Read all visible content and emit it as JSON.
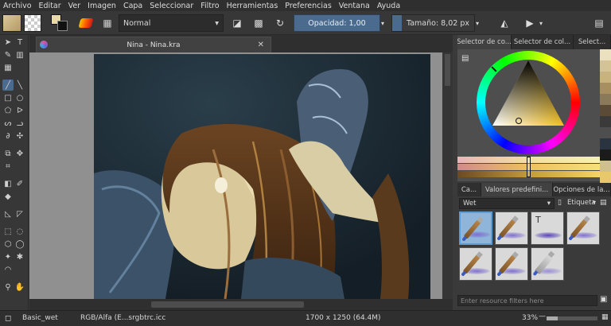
{
  "menu": [
    "Archivo",
    "Editar",
    "Ver",
    "Imagen",
    "Capa",
    "Seleccionar",
    "Filtro",
    "Herramientas",
    "Preferencias",
    "Ventana",
    "Ayuda"
  ],
  "toolbar": {
    "blend_mode": "Normal",
    "opacity_label": "Opacidad: 1,00",
    "opacity_value": 1.0,
    "size_label": "Tamaño: 8,02 px"
  },
  "document": {
    "tab_title": "Nina - Nina.kra"
  },
  "dockers": {
    "color_tabs": [
      "Selector de co...",
      "Selector de col...",
      "Select..."
    ],
    "preset_tabs": [
      "Ca...",
      "Valores predefini...",
      "Opciones de la..."
    ],
    "preset_filter_value": "Wet",
    "tag_label": "Etiqueta",
    "filter_placeholder": "Enter resource filters here",
    "colors": {
      "accent": "#4a6a8e",
      "foreground": "#e8d9a6",
      "background": "#111111"
    }
  },
  "status": {
    "preset_name": "Basic_wet",
    "color_profile": "RGB/Alfa (E...srgbtrc.icc",
    "dimensions": "1700 x 1250 (64.4M)",
    "zoom": "33%"
  }
}
